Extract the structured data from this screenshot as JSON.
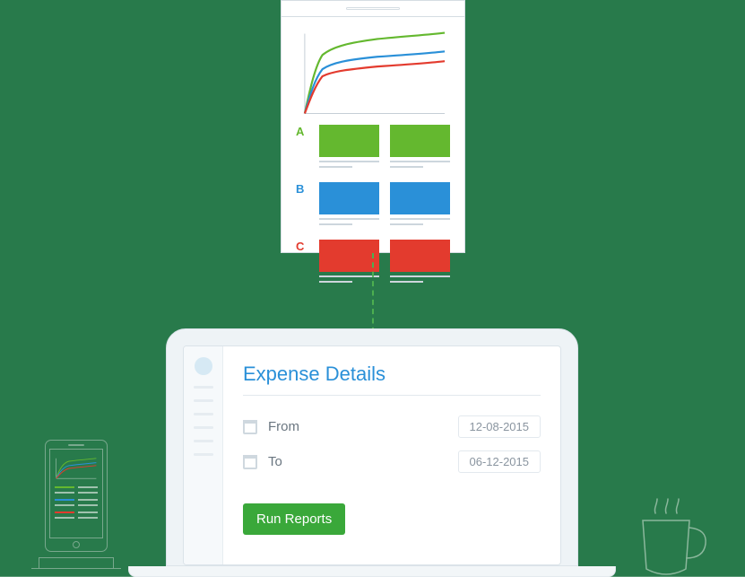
{
  "report": {
    "legend": {
      "A": "A",
      "B": "B",
      "C": "C"
    }
  },
  "expense": {
    "title": "Expense Details",
    "from_label": "From",
    "to_label": "To",
    "from_value": "12-08-2015",
    "to_value": "06-12-2015",
    "run_button": "Run Reports"
  },
  "colors": {
    "green": "#64b82f",
    "blue": "#2a90d8",
    "red": "#e33b2e",
    "accent_btn": "#3aa83a"
  },
  "chart_data": {
    "type": "line",
    "xlim": [
      0,
      100
    ],
    "ylim": [
      0,
      100
    ],
    "series": [
      {
        "name": "A",
        "color": "#64b82f",
        "x": [
          0,
          3,
          6,
          10,
          15,
          22,
          35,
          55,
          80,
          100
        ],
        "y": [
          0,
          28,
          48,
          60,
          68,
          74,
          80,
          86,
          91,
          95
        ]
      },
      {
        "name": "B",
        "color": "#2a90d8",
        "x": [
          0,
          3,
          6,
          10,
          15,
          22,
          35,
          55,
          80,
          100
        ],
        "y": [
          0,
          22,
          38,
          48,
          54,
          58,
          62,
          66,
          70,
          73
        ]
      },
      {
        "name": "C",
        "color": "#e33b2e",
        "x": [
          0,
          3,
          6,
          10,
          15,
          22,
          35,
          55,
          80,
          100
        ],
        "y": [
          0,
          18,
          32,
          41,
          46,
          50,
          54,
          57,
          60,
          63
        ]
      }
    ],
    "xlabel": "",
    "ylabel": "",
    "title": ""
  }
}
